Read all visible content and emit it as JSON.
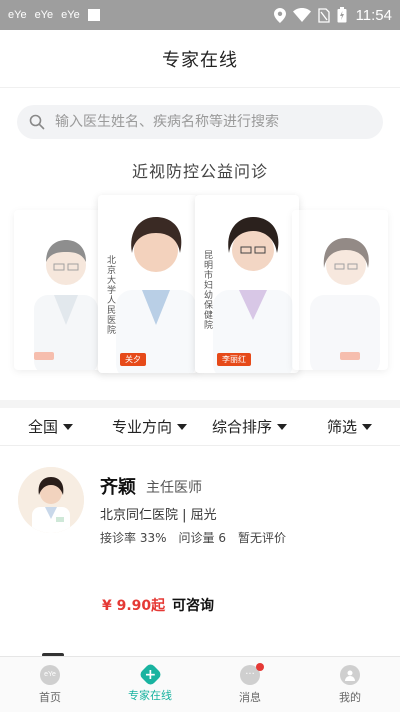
{
  "status_bar": {
    "notifications": [
      "eYe",
      "eYe",
      "eYe"
    ],
    "time": "11:54"
  },
  "header": {
    "title": "专家在线"
  },
  "search": {
    "placeholder": "输入医生姓名、疾病名称等进行搜索"
  },
  "banner": {
    "title": "近视防控公益问诊",
    "cards": [
      {
        "tag": "",
        "hospital_vertical": ""
      },
      {
        "tag": "关夕",
        "hospital_vertical": "北京大学人民医院"
      },
      {
        "tag": "李丽红",
        "hospital_vertical": "昆明市妇幼保健院"
      },
      {
        "tag": "",
        "hospital_vertical": ""
      }
    ]
  },
  "filters": [
    {
      "label": "全国"
    },
    {
      "label": "专业方向"
    },
    {
      "label": "综合排序"
    },
    {
      "label": "筛选"
    }
  ],
  "doctor": {
    "name": "齐颖",
    "title": "主任医师",
    "hospital": "北京同仁医院 | 屈光",
    "consult_rate": "接诊率 33%",
    "consult_count": "问诊量 6",
    "rating": "暂无评价",
    "price": "¥ 9.90起",
    "consult_label": "可咨询"
  },
  "bottom_nav": [
    {
      "label": "首页",
      "icon": "home-eye-icon",
      "active": false
    },
    {
      "label": "专家在线",
      "icon": "plus-cross-icon",
      "active": true
    },
    {
      "label": "消息",
      "icon": "message-icon",
      "active": false,
      "badge": true
    },
    {
      "label": "我的",
      "icon": "profile-icon",
      "active": false
    }
  ],
  "colors": {
    "accent": "#19b3a0",
    "price": "#e53935",
    "status_bar": "#9e9e9e"
  }
}
